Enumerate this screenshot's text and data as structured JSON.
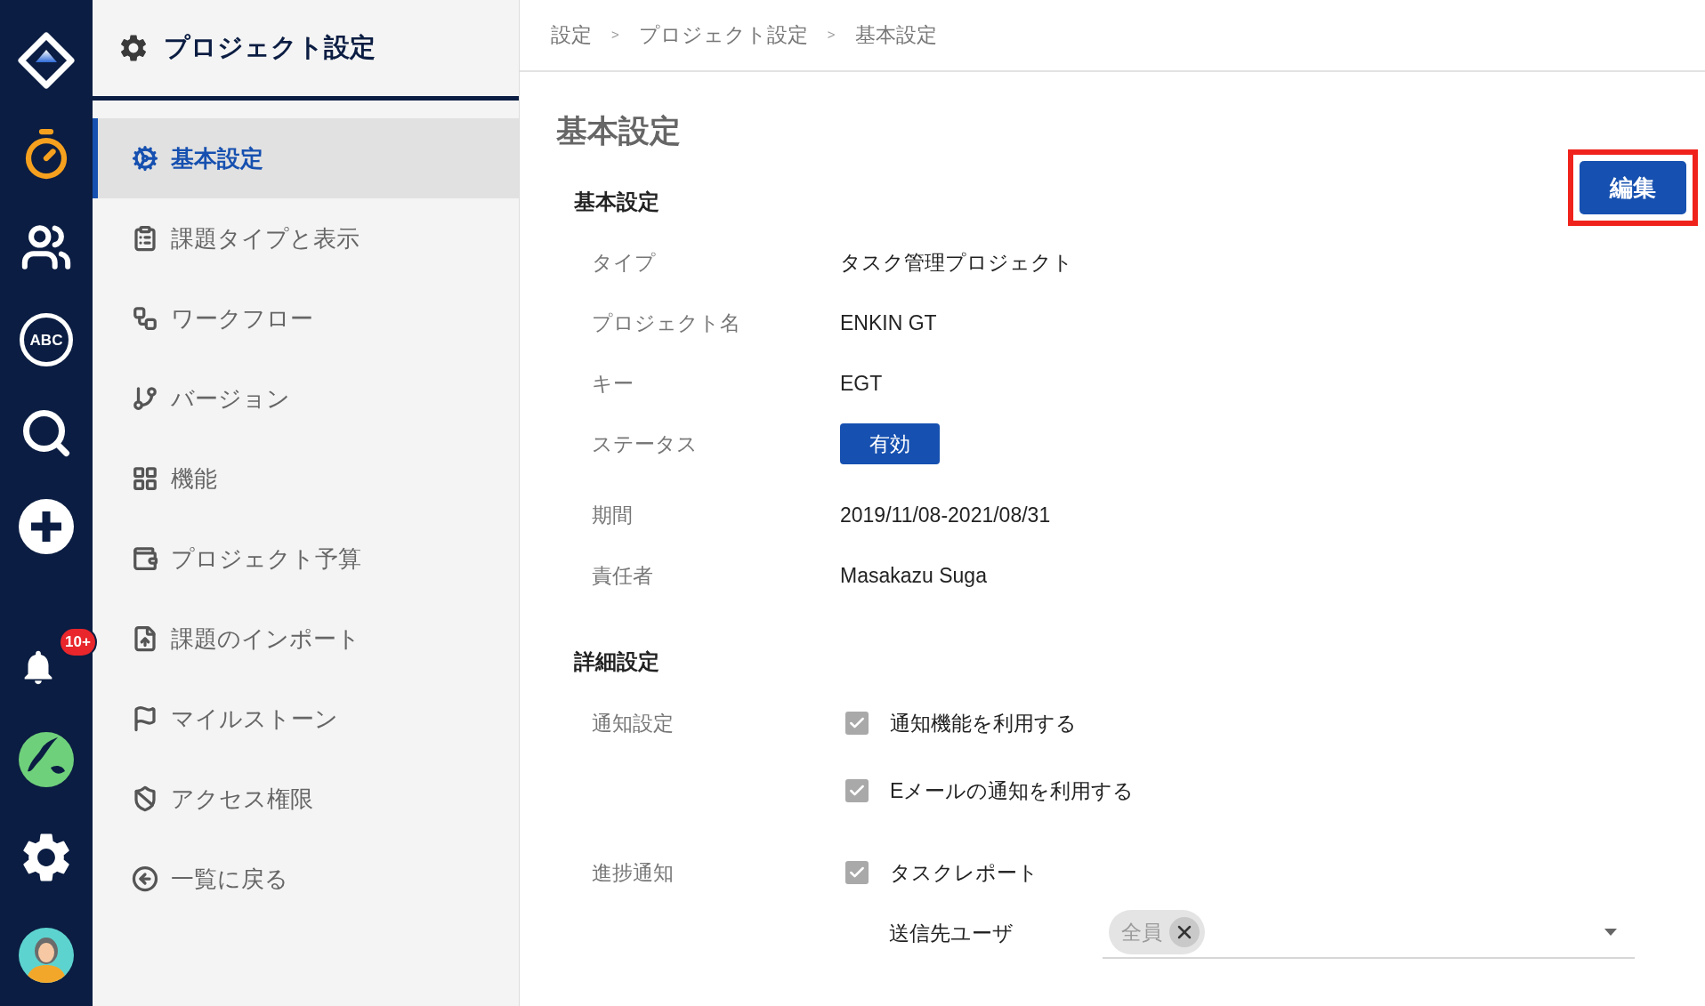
{
  "rail": {
    "abc_label": "ABC",
    "badge": "10+"
  },
  "sidebar": {
    "title": "プロジェクト設定",
    "items": [
      {
        "label": "基本設定",
        "selected": true
      },
      {
        "label": "課題タイプと表示",
        "selected": false
      },
      {
        "label": "ワークフロー",
        "selected": false
      },
      {
        "label": "バージョン",
        "selected": false
      },
      {
        "label": "機能",
        "selected": false
      },
      {
        "label": "プロジェクト予算",
        "selected": false
      },
      {
        "label": "課題のインポート",
        "selected": false
      },
      {
        "label": "マイルストーン",
        "selected": false
      },
      {
        "label": "アクセス権限",
        "selected": false
      },
      {
        "label": "一覧に戻る",
        "selected": false
      }
    ]
  },
  "breadcrumb": {
    "items": [
      "設定",
      "プロジェクト設定",
      "基本設定"
    ],
    "separator": ">"
  },
  "page": {
    "title": "基本設定",
    "edit_button": "編集",
    "basic": {
      "heading": "基本設定",
      "rows": [
        {
          "kind": "text",
          "label": "タイプ",
          "value": "タスク管理プロジェクト"
        },
        {
          "kind": "text",
          "label": "プロジェクト名",
          "value": "ENKIN GT"
        },
        {
          "kind": "text",
          "label": "キー",
          "value": "EGT"
        },
        {
          "kind": "badge",
          "label": "ステータス",
          "value": "有効"
        },
        {
          "kind": "text",
          "label": "期間",
          "value": "2019/11/08-2021/08/31"
        },
        {
          "kind": "text",
          "label": "責任者",
          "value": "Masakazu Suga"
        }
      ]
    },
    "details": {
      "heading": "詳細設定",
      "groups": [
        {
          "label": "通知設定",
          "options": [
            {
              "text": "通知機能を利用する",
              "checked": true
            },
            {
              "text": "Eメールの通知を利用する",
              "checked": true
            }
          ]
        },
        {
          "label": "進捗通知",
          "options": [
            {
              "text": "タスクレポート",
              "checked": true,
              "recipients": {
                "label": "送信先ユーザ",
                "chips": [
                  "全員"
                ]
              }
            }
          ]
        }
      ]
    }
  }
}
